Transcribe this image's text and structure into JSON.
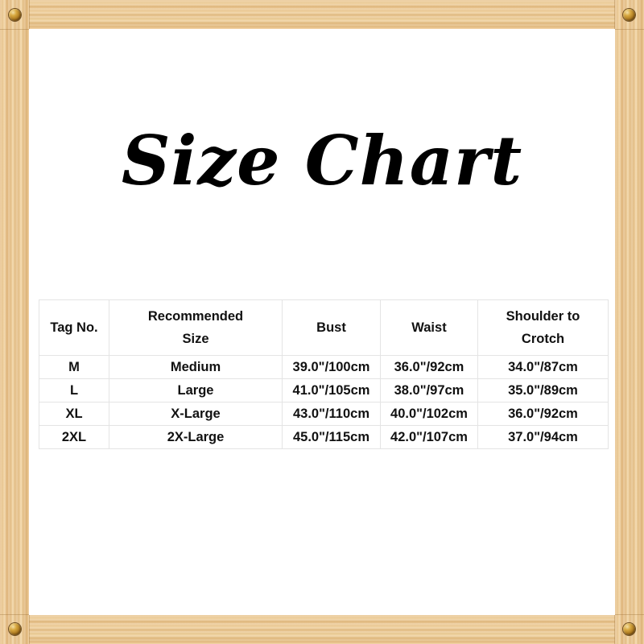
{
  "frame": {
    "material": "wood",
    "wood_color": "#e8c490",
    "screw_color": "#b8862c",
    "screw_positions": [
      "top-left",
      "top-right",
      "bottom-left",
      "bottom-right"
    ]
  },
  "title": "Size Chart",
  "table": {
    "headers": [
      {
        "line1": "Tag No.",
        "line2": ""
      },
      {
        "line1": "Recommended",
        "line2": "Size"
      },
      {
        "line1": "Bust",
        "line2": ""
      },
      {
        "line1": "Waist",
        "line2": ""
      },
      {
        "line1": "Shoulder to",
        "line2": "Crotch"
      }
    ],
    "rows": [
      {
        "tag": "M",
        "recommended": "Medium",
        "bust": "39.0\"/100cm",
        "waist": "36.0\"/92cm",
        "shoulder_to_crotch": "34.0\"/87cm"
      },
      {
        "tag": "L",
        "recommended": "Large",
        "bust": "41.0\"/105cm",
        "waist": "38.0\"/97cm",
        "shoulder_to_crotch": "35.0\"/89cm"
      },
      {
        "tag": "XL",
        "recommended": "X-Large",
        "bust": "43.0\"/110cm",
        "waist": "40.0\"/102cm",
        "shoulder_to_crotch": "36.0\"/92cm"
      },
      {
        "tag": "2XL",
        "recommended": "2X-Large",
        "bust": "45.0\"/115cm",
        "waist": "42.0\"/107cm",
        "shoulder_to_crotch": "37.0\"/94cm"
      }
    ]
  }
}
